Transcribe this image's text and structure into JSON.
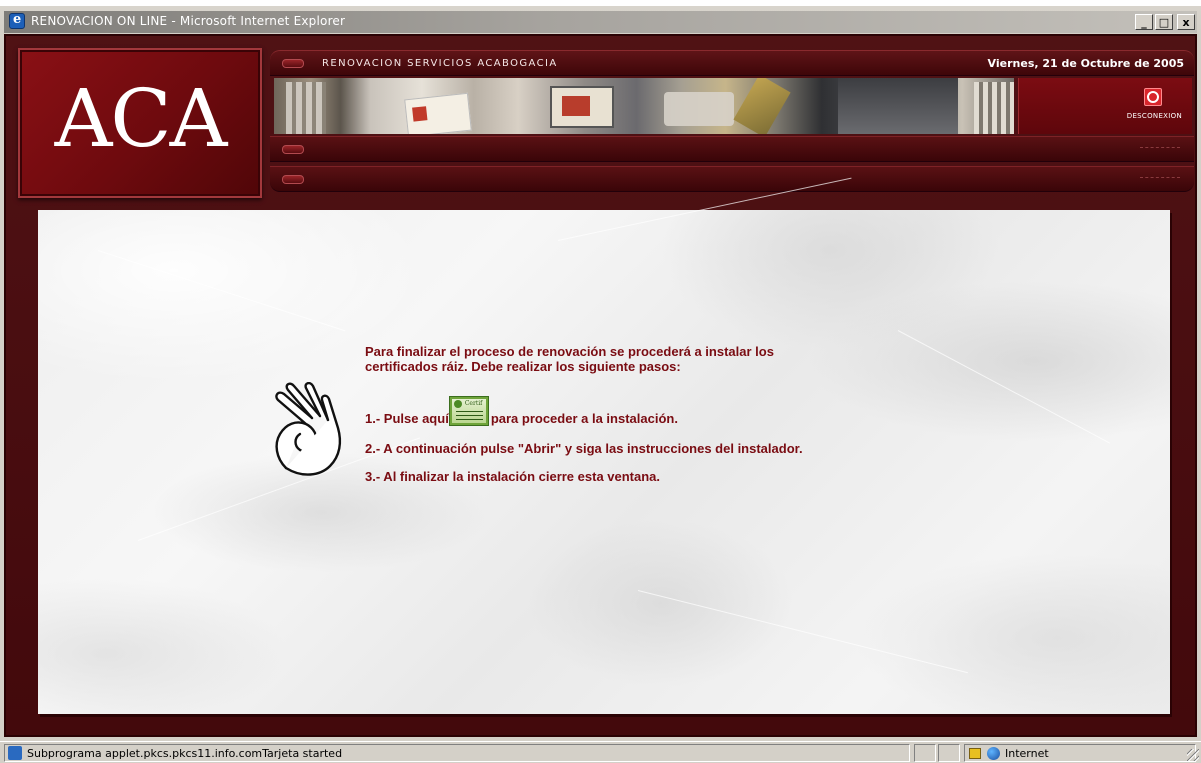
{
  "window": {
    "title": "RENOVACION ON LINE - Microsoft Internet Explorer",
    "controls": {
      "minimize": "_",
      "maximize": "□",
      "close": "x"
    }
  },
  "header": {
    "logo_text": "ACA",
    "service_title": "RENOVACION SERVICIOS ACABOGACIA",
    "date": "Viernes, 21 de Octubre de 2005",
    "disconnect_label": "DESCONEXION",
    "disconnect_icon": "power-icon"
  },
  "main": {
    "intro": "Para finalizar el proceso de renovación se procederá a instalar los certificados ráiz. Debe realizar los siguiente pasos:",
    "step1_prefix": "1.- Pulse aquí",
    "step1_suffix": "para proceder a la instalación.",
    "step1_icon": "certificate-install-icon",
    "step2": "2.- A continuación pulse \"Abrir\" y siga las instrucciones del instalador.",
    "step3": "3.- Al finalizar la instalación cierre esta ventana.",
    "hand_icon": "ok-hand-icon",
    "text_color": "#7a0c12"
  },
  "statusbar": {
    "message": "Subprograma applet.pkcs.pkcs11.info.comTarjeta started",
    "zone": "Internet"
  },
  "colors": {
    "frame": "#4a0a0d",
    "accent": "#7c0c12"
  }
}
